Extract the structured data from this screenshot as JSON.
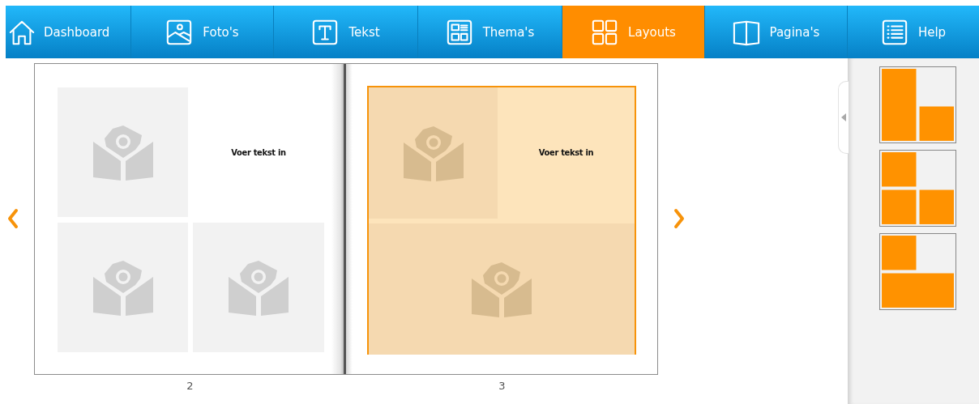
{
  "nav": [
    {
      "label": "Dashboard",
      "kind": "house",
      "selected": false
    },
    {
      "label": "Foto's",
      "kind": "photo",
      "selected": false
    },
    {
      "label": "Tekst",
      "kind": "text",
      "selected": false
    },
    {
      "label": "Thema's",
      "kind": "theme",
      "selected": false
    },
    {
      "label": "Layouts",
      "kind": "layouts",
      "selected": true
    },
    {
      "label": "Pagina's",
      "kind": "book",
      "selected": false
    },
    {
      "label": "Help",
      "kind": "list",
      "selected": false
    }
  ],
  "spread": {
    "pages": [
      {
        "number": "2",
        "kind": "four",
        "selected": false,
        "slots": [
          {
            "kind": "photo"
          },
          {
            "kind": "text",
            "text": "Voer tekst in"
          },
          {
            "kind": "photo"
          },
          {
            "kind": "photo"
          }
        ]
      },
      {
        "number": "3",
        "kind": "three-wide",
        "selected": true,
        "slots": [
          {
            "kind": "photo"
          },
          {
            "kind": "text",
            "text": "Voer tekst in"
          },
          {
            "kind": "photo"
          }
        ]
      }
    ]
  },
  "layouts": [
    {
      "kind": "tall-left"
    },
    {
      "kind": "one-top-two-bottom"
    },
    {
      "kind": "one-top-wide-bottom"
    }
  ]
}
